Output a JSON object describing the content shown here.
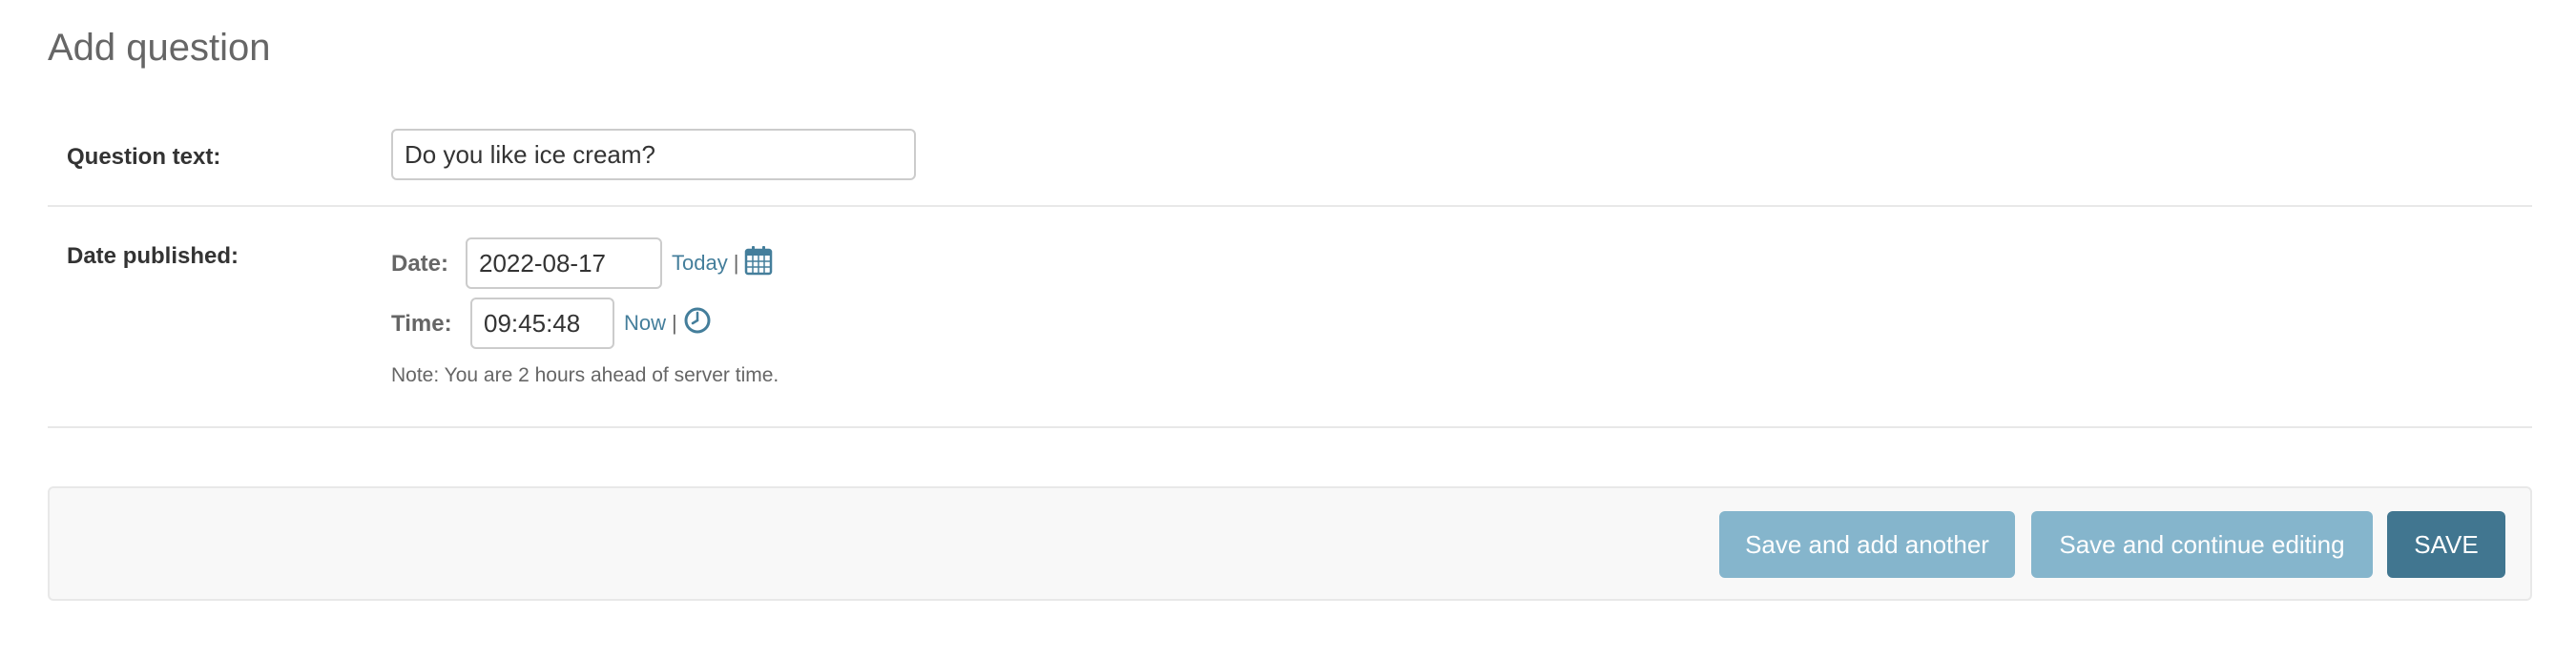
{
  "page": {
    "title": "Add question"
  },
  "question_field": {
    "label": "Question text:",
    "value": "Do you like ice cream?"
  },
  "date_published": {
    "label": "Date published:",
    "date_label": "Date:",
    "date_value": "2022-08-17",
    "today_link": "Today",
    "separator": "|",
    "time_label": "Time:",
    "time_value": "09:45:48",
    "now_link": "Now",
    "note": "Note: You are 2 hours ahead of server time."
  },
  "icons": {
    "calendar": "calendar-icon",
    "clock": "clock-icon"
  },
  "submit_row": {
    "save_add_another": "Save and add another",
    "save_continue": "Save and continue editing",
    "save": "SAVE"
  },
  "colors": {
    "primary": "#417690",
    "secondary": "#79aec8",
    "link": "#447e9b"
  }
}
